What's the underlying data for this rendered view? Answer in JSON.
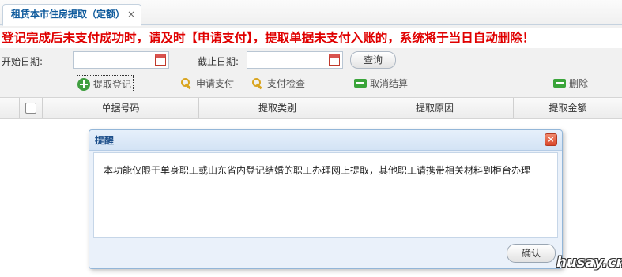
{
  "tab": {
    "title": "租赁本市住房提取（定额）",
    "close": "×"
  },
  "warning": "登记完成后未支付成功时，请及时【申请支付】，提取单据未支付入账的，系统将于当日自动删除！",
  "search": {
    "start_label": "开始日期:",
    "start_value": "",
    "end_label": "截止日期:",
    "end_value": "",
    "query_label": "查询"
  },
  "toolbar": {
    "register": "提取登记",
    "apply_pay": "申请支付",
    "check_pay": "支付检查",
    "cancel_settle": "取消结算",
    "delete": "删除"
  },
  "grid": {
    "columns": [
      "单据号码",
      "提取类别",
      "提取原因",
      "提取金额"
    ]
  },
  "dialog": {
    "title": "提醒",
    "close": "×",
    "message": "本功能仅限于单身职工或山东省内登记结婚的职工办理网上提取，其他职工请携带相关材料到柜台办理",
    "ok": "确认"
  },
  "watermark": "husay.cn",
  "colors": {
    "warning": "#e00000",
    "tab_text": "#0e5a9c",
    "dialog_title": "#1d4f8a"
  }
}
